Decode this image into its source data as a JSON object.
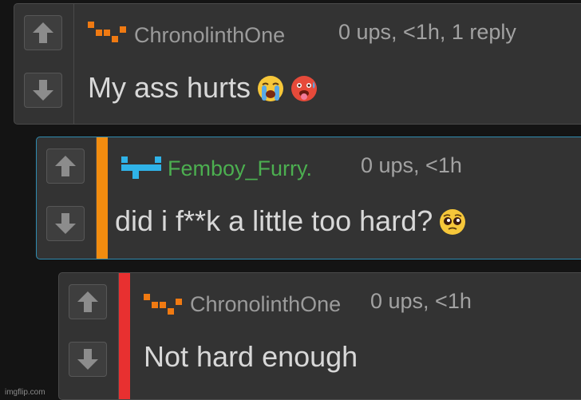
{
  "comments": [
    {
      "username": "ChronolinthOne",
      "meta": "0 ups, <1h, 1 reply",
      "text": "My ass hurts",
      "emojis": [
        "loudly-crying-face-emoji",
        "hot-face-emoji"
      ],
      "avatar_color": "#f07a12",
      "username_color": "#9b9b9b"
    },
    {
      "username": "Femboy_Furry.",
      "meta": "0 ups, <1h",
      "text": "did i f**k a little too hard?",
      "emojis": [
        "pleading-face-emoji"
      ],
      "avatar_color": "#2fb3e8",
      "username_color": "#4caf50",
      "depth_bar_color": "#f28c0f"
    },
    {
      "username": "ChronolinthOne",
      "meta": "0 ups, <1h",
      "text": "Not hard enough",
      "emojis": [],
      "avatar_color": "#f07a12",
      "username_color": "#9b9b9b",
      "depth_bar_color": "#e83030"
    }
  ],
  "icons": {
    "upvote": "up-arrow-icon",
    "downvote": "down-arrow-icon"
  },
  "watermark": "imgflip.com"
}
